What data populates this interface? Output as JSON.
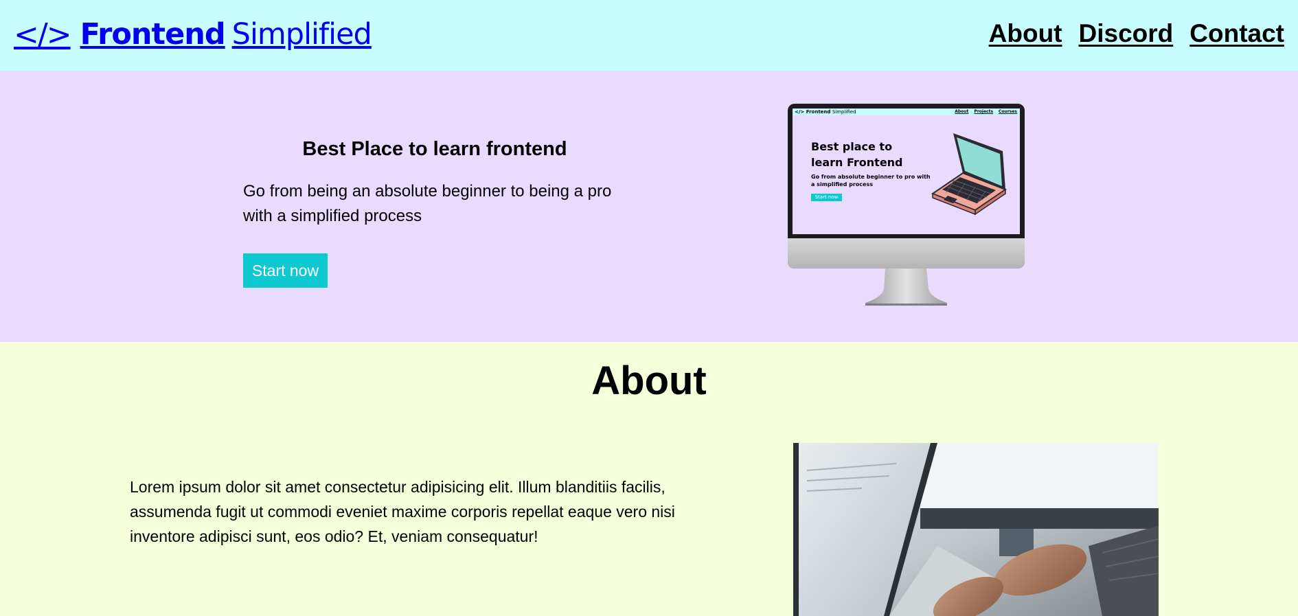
{
  "header": {
    "logo_icon": "</>",
    "logo_strong": "Frontend",
    "logo_light": "Simplified",
    "nav": [
      {
        "label": "About"
      },
      {
        "label": "Discord"
      },
      {
        "label": "Contact"
      }
    ]
  },
  "hero": {
    "title": "Best Place to learn frontend",
    "subtitle": "Go from being an absolute beginner to being a pro with a simplified process",
    "button_label": "Start now",
    "illustration": {
      "logo_icon": "</>",
      "logo_strong": "Frontend",
      "logo_light": "Simplified",
      "nav": [
        "About",
        "Projects",
        "Courses"
      ],
      "title": "Best place to learn Frontend",
      "subtitle": "Go from absolute beginner to pro with a simplified process",
      "button_label": "Start now"
    }
  },
  "about": {
    "title": "About",
    "text": "Lorem ipsum dolor sit amet consectetur adipisicing elit. Illum blanditiis facilis, assumenda fugit ut commodi eveniet maxime corporis repellat eaque vero nisi inventore adipisci sunt, eos odio? Et, veniam consequatur!"
  },
  "colors": {
    "header_bg": "#c7fdfe",
    "hero_bg": "#e8dbff",
    "about_bg": "#f5ffda",
    "accent": "#0fc9d1"
  }
}
